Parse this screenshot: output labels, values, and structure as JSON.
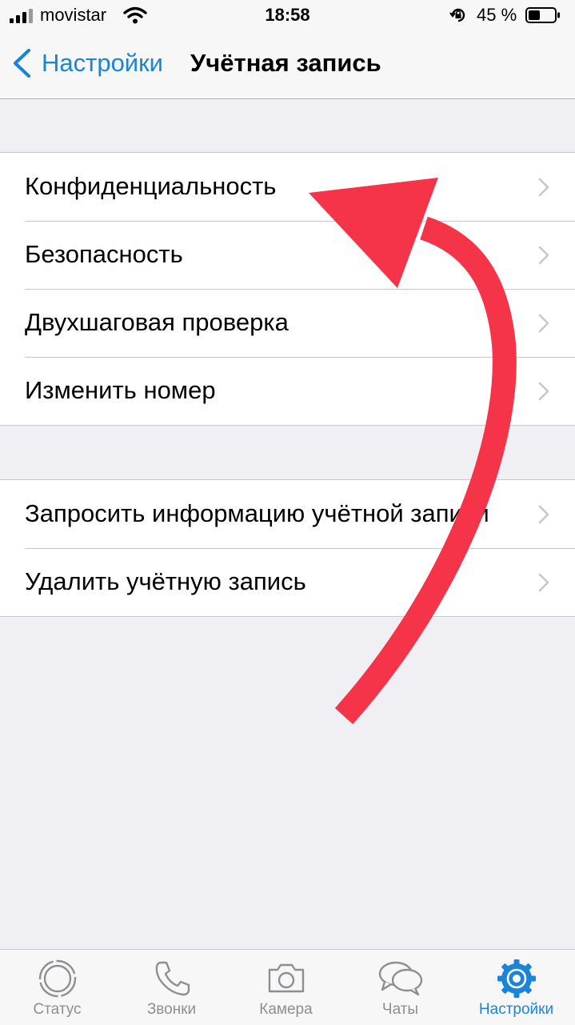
{
  "status_bar": {
    "carrier": "movistar",
    "time": "18:58",
    "battery_percent": "45 %",
    "battery_level": 0.45
  },
  "nav": {
    "back_label": "Настройки",
    "title": "Учётная запись"
  },
  "groups": [
    {
      "items": [
        {
          "label": "Конфиденциальность",
          "icon": "chevron-right-icon"
        },
        {
          "label": "Безопасность",
          "icon": "chevron-right-icon"
        },
        {
          "label": "Двухшаговая проверка",
          "icon": "chevron-right-icon"
        },
        {
          "label": "Изменить номер",
          "icon": "chevron-right-icon"
        }
      ]
    },
    {
      "items": [
        {
          "label": "Запросить информацию учётной записи",
          "icon": "chevron-right-icon"
        },
        {
          "label": "Удалить учётную запись",
          "icon": "chevron-right-icon"
        }
      ]
    }
  ],
  "tab_bar": {
    "tabs": [
      {
        "label": "Статус",
        "icon": "status-icon",
        "active": false
      },
      {
        "label": "Звонки",
        "icon": "phone-icon",
        "active": false
      },
      {
        "label": "Камера",
        "icon": "camera-icon",
        "active": false
      },
      {
        "label": "Чаты",
        "icon": "chat-bubbles-icon",
        "active": false
      },
      {
        "label": "Настройки",
        "icon": "gear-icon",
        "active": true
      }
    ]
  },
  "colors": {
    "accent": "#1a84d8",
    "inactive": "#8e8e93",
    "annotation_arrow": "#f5344a",
    "background": "#efeff4"
  }
}
